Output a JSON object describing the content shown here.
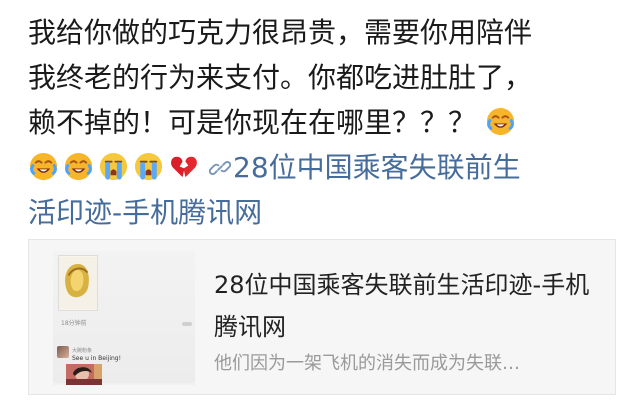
{
  "post": {
    "line1": "我给你做的巧克力很昂贵，需要你用陪伴",
    "line2": "我终老的行为来支付。你都吃进肚肚了，",
    "line3_text": "赖不掉的！可是你现在在哪里？？？",
    "emoji_line3": "crying-laughing-face",
    "emoji_line4": [
      "crying-laughing-face",
      "crying-laughing-face",
      "sobbing-face",
      "sobbing-face",
      "broken-heart"
    ],
    "link_text_line4": "28位中国乘客失联前生",
    "link_text_line5": "活印迹-手机腾讯网"
  },
  "card": {
    "title": "28位中国乘客失联前生活印迹-手机腾讯网",
    "description": "他们因为一架飞机的消失而成为失联…",
    "thumbnail": {
      "mini_label": "18分钟前",
      "mini_name": "大碗粉条",
      "mini_caption": "See u in Beijing!"
    }
  },
  "colors": {
    "text": "#1a1a1a",
    "link": "#466c9b",
    "card_background": "#f6f6f6",
    "muted_text": "#9a9a9a"
  }
}
